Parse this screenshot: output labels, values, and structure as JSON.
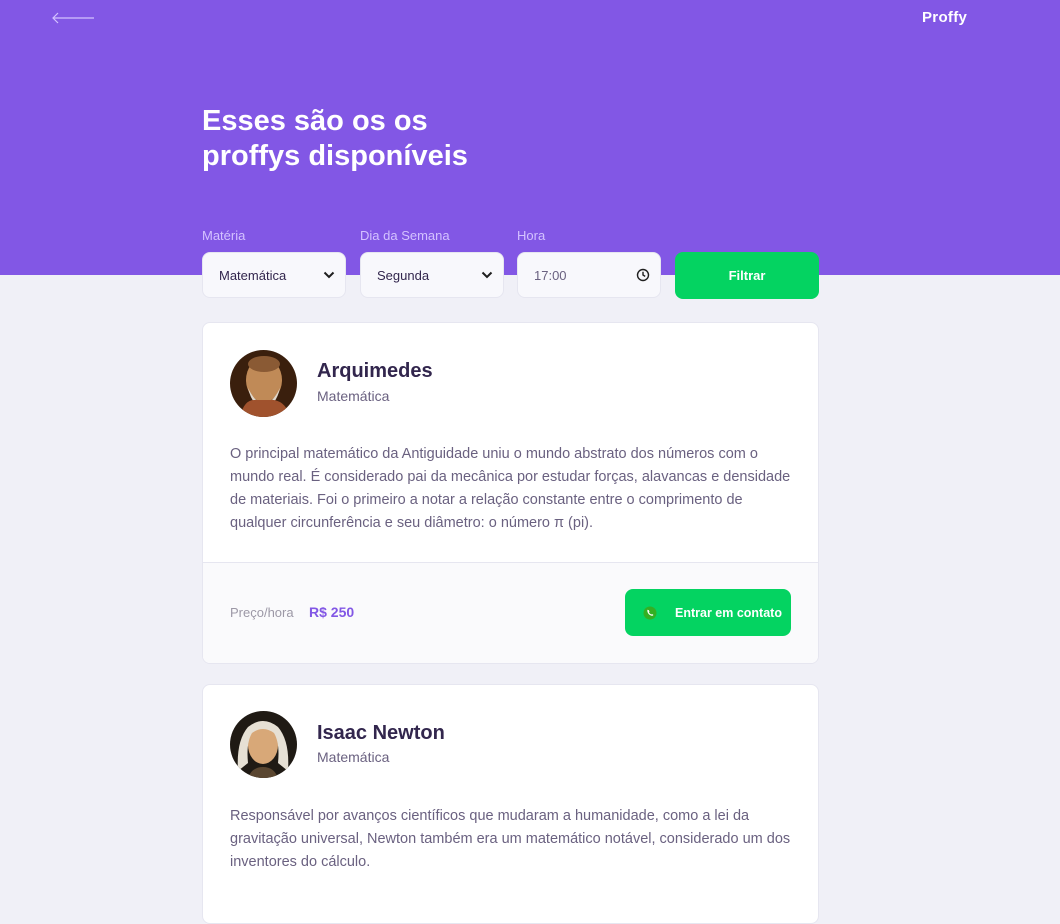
{
  "header": {
    "logo": "Proffy",
    "title_line1": "Esses são os os",
    "title_line2": "proffys disponíveis"
  },
  "filters": {
    "subject_label": "Matéria",
    "subject_value": "Matemática",
    "weekday_label": "Dia da Semana",
    "weekday_value": "Segunda",
    "time_label": "Hora",
    "time_value": "17:00",
    "submit_label": "Filtrar"
  },
  "teachers": [
    {
      "name": "Arquimedes",
      "subject": "Matemática",
      "bio": "O principal matemático da Antiguidade uniu o mundo abstrato dos números com o mundo real. É considerado pai da mecânica por estudar forças, alavancas e densidade de materiais. Foi o primeiro a notar a relação constante entre o comprimento de qualquer circunferência e seu diâmetro: o número π (pi).",
      "price_label": "Preço/hora",
      "price": "R$ 250",
      "contact_label": "Entrar em contato"
    },
    {
      "name": "Isaac Newton",
      "subject": "Matemática",
      "bio": "Responsável por avanços científicos que mudaram a humanidade, como a lei da gravitação universal, Newton também era um matemático notável, considerado um dos inventores do cálculo."
    }
  ],
  "colors": {
    "primary": "#8257e5",
    "secondary": "#04d361",
    "background": "#f0f0f7",
    "title_text": "#32264d",
    "body_text": "#6a6180"
  },
  "icons": {
    "back": "arrow-left-icon",
    "select": "chevron-down-icon",
    "time": "clock-icon",
    "contact": "whatsapp-icon"
  }
}
